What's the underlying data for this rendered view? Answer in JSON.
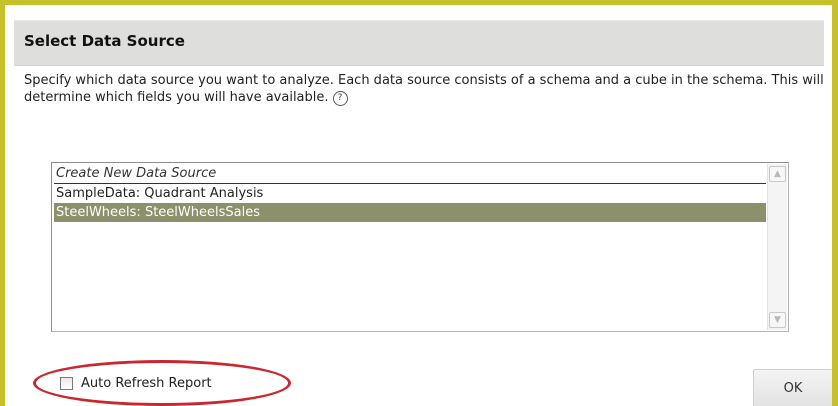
{
  "dialog": {
    "title": "Select Data Source",
    "description": "Specify which data source you want to analyze. Each data source consists of a schema and a cube in the schema. This will determine which fields you will have available.",
    "help_icon": "help-circle-icon",
    "help_glyph": "?"
  },
  "datasource_list": {
    "items": [
      {
        "label": "Create New Data Source"
      },
      {
        "label": "SampleData: Quadrant Analysis"
      },
      {
        "label": "SteelWheels: SteelWheelsSales"
      }
    ],
    "selected_index": 2,
    "selected_color": "#8c916b"
  },
  "scrollbar": {
    "up_glyph": "▲",
    "down_glyph": "▼"
  },
  "auto_refresh": {
    "label": "Auto Refresh Report",
    "checked": false
  },
  "buttons": {
    "ok_label": "OK"
  },
  "colors": {
    "frame_border": "#c6c12a",
    "title_bar": "#dededc",
    "annotation_oval": "#c8282e"
  }
}
